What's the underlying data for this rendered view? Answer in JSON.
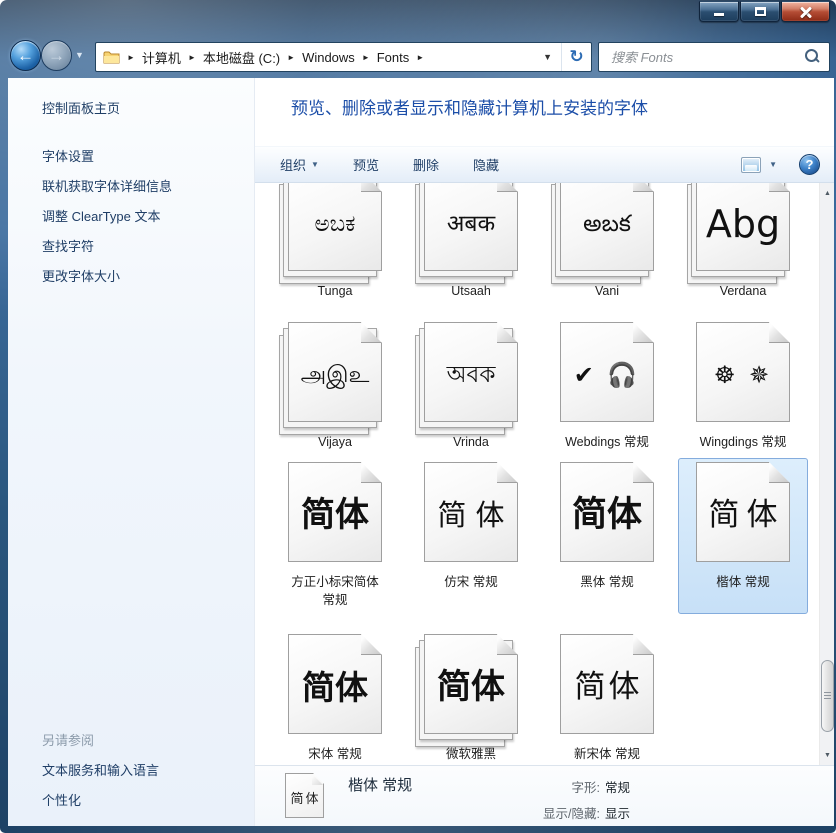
{
  "colors": {
    "frame_blue": "#2e5d8e",
    "header_text_blue": "#1c4ea8",
    "sidebar_link": "#1f3e66",
    "selection_fill": "#cde2f7",
    "selection_border": "#84acdd",
    "close_button_red": "#b44d35"
  },
  "window": {
    "caption_icons": [
      "minimize-icon",
      "maximize-icon",
      "close-icon"
    ]
  },
  "navbar": {
    "back_icon": "←",
    "forward_icon": "→",
    "folder_icon": "folder-icon",
    "breadcrumb_items": [
      "计算机",
      "本地磁盘 (C:)",
      "Windows",
      "Fonts"
    ],
    "refresh_icon": "↻",
    "search_placeholder": "搜索 Fonts"
  },
  "sidebar": {
    "home": "控制面板主页",
    "tasks": [
      "字体设置",
      "联机获取字体详细信息",
      "调整 ClearType 文本",
      "查找字符",
      "更改字体大小"
    ],
    "see_also_header": "另请参阅",
    "see_also_links": [
      "文本服务和输入语言",
      "个性化"
    ]
  },
  "main": {
    "header_title": "预览、删除或者显示和隐藏计算机上安装的字体",
    "toolbar": {
      "organize": "组织",
      "preview": "预览",
      "delete": "删除",
      "hide": "隐藏",
      "views_icon": "views-thumbnail-icon",
      "help_icon": "help-icon"
    },
    "fonts": [
      {
        "label": "Tunga",
        "glyph": "ಅಬಕ",
        "style": "indic",
        "stacked": true,
        "selected": false
      },
      {
        "label": "Utsaah",
        "glyph": "अबक",
        "style": "indic",
        "stacked": true,
        "selected": false
      },
      {
        "label": "Vani",
        "glyph": "అబక",
        "style": "indic",
        "stacked": true,
        "selected": false
      },
      {
        "label": "Verdana",
        "glyph": "Abg",
        "style": "latin",
        "stacked": true,
        "selected": false
      },
      {
        "label": "Vijaya",
        "glyph": "அஇஉ",
        "style": "indic",
        "stacked": true,
        "selected": false
      },
      {
        "label": "Vrinda",
        "glyph": "অবক",
        "style": "indic",
        "stacked": true,
        "selected": false
      },
      {
        "label": "Webdings 常规",
        "glyph": "✔ 🎧",
        "style": "dings",
        "stacked": false,
        "selected": false
      },
      {
        "label": "Wingdings 常规",
        "glyph": "☸ ✵",
        "style": "dings",
        "stacked": false,
        "selected": false
      },
      {
        "label": "方正小标宋简体\n常规",
        "glyph": "简体",
        "style": "cn-bold-serif",
        "stacked": false,
        "selected": false
      },
      {
        "label": "仿宋 常规",
        "glyph": "简体",
        "style": "cn-fangsong",
        "stacked": false,
        "selected": false
      },
      {
        "label": "黑体 常规",
        "glyph": "简体",
        "style": "cn-heiti",
        "stacked": false,
        "selected": false
      },
      {
        "label": "楷体 常规",
        "glyph": "简体",
        "style": "cn-kaiti",
        "stacked": false,
        "selected": true
      },
      {
        "label": "宋体 常规",
        "glyph": "简体",
        "style": "cn-songti",
        "stacked": false,
        "selected": false
      },
      {
        "label": "微软雅黑",
        "glyph": "简体",
        "style": "cn-yahei",
        "stacked": true,
        "selected": false
      },
      {
        "label": "新宋体 常规",
        "glyph": "简体",
        "style": "cn-xinsong",
        "stacked": false,
        "selected": false
      }
    ],
    "details": {
      "icon_glyph": "简体",
      "name": "楷体 常规",
      "properties": [
        {
          "label": "字形:",
          "value": "常规"
        },
        {
          "label": "显示/隐藏:",
          "value": "显示"
        }
      ]
    }
  }
}
